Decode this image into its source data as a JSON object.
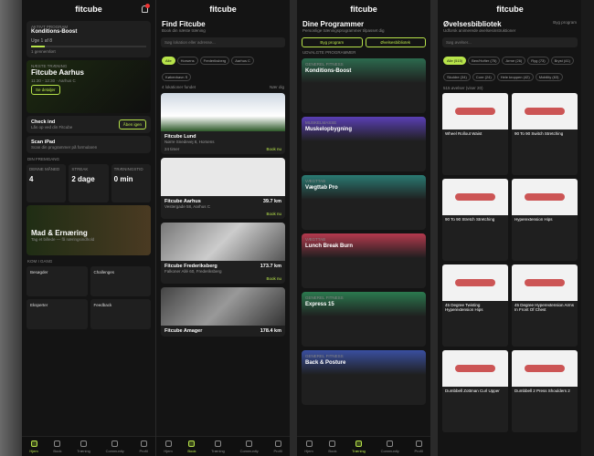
{
  "brand": "fitcube",
  "s1": {
    "prog_tag": "AKTIVT PROGRAM",
    "prog_name": "Konditions-Boost",
    "prog_week": "Uge 1 af 8",
    "prog_count": "1 gennemført",
    "next_tag": "NÆSTE TRÆNING",
    "next_title": "Fitcube Aarhus",
    "next_badge": "1 Dag",
    "next_time": "11:30 - 12:30",
    "next_loc": "Aarhus C",
    "next_btn": "Se detaljer",
    "checkin": "Check ind",
    "checkin_sub": "Lås op ved din Fitcube",
    "checkin_btn": "Åben igen",
    "scan": "Scan iPad",
    "scan_sub": "Scan din programmer på formularen",
    "prog_head": "DIN FREMGANG",
    "stats": [
      {
        "l": "DENNE MÅNED",
        "v": "4"
      },
      {
        "l": "STREAK",
        "v": "2 dage"
      },
      {
        "l": "TRÆNINGSTID",
        "v": "0 min"
      }
    ],
    "food": "Mad & Ernæring",
    "food_sub": "Tag et billede — få næringsindhold",
    "more_head": "KOM I GANG",
    "tiles": [
      "Besøgder",
      "Challenges",
      "Eksperter",
      "Feedback"
    ],
    "nav": [
      "Hjem",
      "Book",
      "Træning",
      "Community",
      "Profil"
    ]
  },
  "s2": {
    "title": "Find Fitcube",
    "sub": "Book din næste træning",
    "search": "Søg lokation eller adresse...",
    "filters": [
      "Alle",
      "Horsens",
      "Frederiksberg",
      "Aarhus C",
      "København S"
    ],
    "found": "4 lokationer fundet",
    "near": "Nær dig",
    "gyms": [
      {
        "name": "Fitcube Lund",
        "addr": "Nørre Snedevej 8, Horsens",
        "dist": "24 timer",
        "book": "Book nu"
      },
      {
        "name": "Fitcube Aarhus",
        "addr": "Vestergade 58, Aarhus C",
        "dist": "39.7 km",
        "book": "Book nu"
      },
      {
        "name": "Fitcube Frederiksberg",
        "addr": "Falkoner Allé 60, Frederiksberg",
        "dist": "173.7 km",
        "book": "Book nu"
      },
      {
        "name": "Fitcube Amager",
        "addr": "",
        "dist": "178.4 km",
        "book": ""
      }
    ]
  },
  "s3": {
    "title": "Dine Programmer",
    "sub": "Personlige træningsprogrammer tilpasset dig",
    "btn1": "Byg program",
    "btn2": "Øvelsesbibliotek",
    "head": "UDVALGTE PROGRAMMER",
    "progs": [
      {
        "tag": "GENEREL FITNESS",
        "name": "Konditions-Boost",
        "c": "#2c6a4e"
      },
      {
        "tag": "MUSKELMASSE",
        "name": "Muskelopbygning",
        "c": "#5a3fb5"
      },
      {
        "tag": "VÆGTTAB",
        "name": "Vægttab Pro",
        "c": "#2a7a72"
      },
      {
        "tag": "VÆGTTAB",
        "name": "Lunch Break Burn",
        "c": "#b53a4e"
      },
      {
        "tag": "GENEREL FITNESS",
        "name": "Express 15",
        "c": "#2b7a4f"
      },
      {
        "tag": "GENEREL FITNESS",
        "name": "Back & Posture",
        "c": "#3a4fa0"
      }
    ]
  },
  "s4": {
    "title": "Øvelsesbibliotek",
    "sub": "Udforsk animerede øvelsesinstruktioner",
    "btn": "Byg program",
    "search": "Søg øvelser...",
    "filters": [
      "Alle (515)",
      "Ben/Hofter (75)",
      "Arme (26)",
      "Ryg (73)",
      "Bryst (41)",
      "Skuldre (34)",
      "Core (24)",
      "Hele kroppen (42)",
      "Mobility (63)"
    ],
    "count": "515 øvelser (viser 20)",
    "ex": [
      "Wheel Rollout Waist",
      "90 To 90 Switch Stretching",
      "90 To 90 Stretch Stretching",
      "Hyperextension Hips",
      "45 Degree Twisting Hyperextension Hips",
      "45 Degree Hyperextension Arms In Front Of Chest",
      "Dumbbell Zottman Curl Upper",
      "Dumbbell 2 Press Shoulders 2"
    ]
  }
}
